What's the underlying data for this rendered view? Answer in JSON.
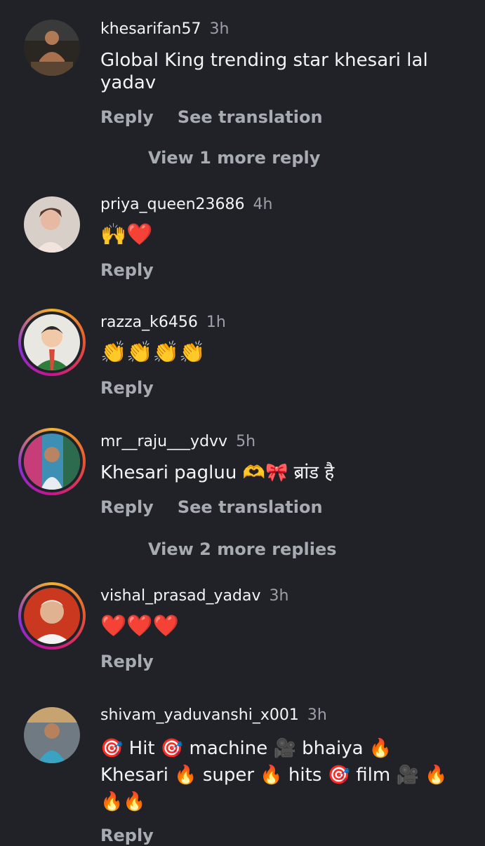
{
  "comments": [
    {
      "username": "khesarifan57",
      "time": "3h",
      "text": "Global King trending star khesari lal yadav",
      "reply": "Reply",
      "translate": "See translation",
      "view_more": "View 1 more reply"
    },
    {
      "username": "priya_queen23686",
      "time": "4h",
      "text": "🙌❤️",
      "reply": "Reply"
    },
    {
      "username": "razza_k6456",
      "time": "1h",
      "text": "👏👏👏👏",
      "reply": "Reply"
    },
    {
      "username": "mr__raju___ydvv",
      "time": "5h",
      "text": "Khesari pagluu 🫶🎀 ब्रांड है",
      "reply": "Reply",
      "translate": "See translation",
      "view_more": "View 2 more replies"
    },
    {
      "username": "vishal_prasad_yadav",
      "time": "3h",
      "text": "❤️❤️❤️",
      "reply": "Reply"
    },
    {
      "username": "shivam_yaduvanshi_x001",
      "time": "3h",
      "text": "🎯 Hit 🎯 machine 🎥 bhaiya 🔥 Khesari 🔥 super 🔥 hits 🎯 film 🎥 🔥🔥🔥",
      "reply": "Reply"
    }
  ],
  "colors": {
    "background": "#212228",
    "primary_text": "#f3f4f6",
    "secondary_text": "#a7abb2",
    "story_ring": [
      "#f4b32a",
      "#e7552f",
      "#c8148b",
      "#8a2fd6"
    ]
  }
}
